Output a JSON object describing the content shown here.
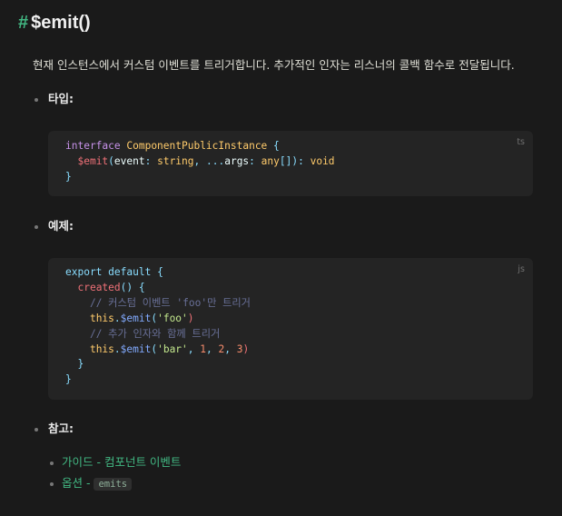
{
  "heading": {
    "hash": "#",
    "title": "$emit()"
  },
  "description": "현재 인스턴스에서 커스텀 이벤트를 트리거합니다. 추가적인 인자는 리스너의 콜백 함수로 전달됩니다.",
  "sections": {
    "type": {
      "label": "타입:",
      "lang": "ts",
      "line1": {
        "kw": "interface",
        "name": "ComponentPublicInstance",
        "brace": " {"
      },
      "line2": {
        "fn": "$emit",
        "p1": "(",
        "arg1": "event",
        "c1": ": ",
        "t1": "string",
        "sep": ", ",
        "spread": "...",
        "arg2": "args",
        "c2": ": ",
        "t2": "any",
        "arr": "[]",
        "p2": ")",
        "c3": ": ",
        "ret": "void"
      },
      "line3": "}"
    },
    "example": {
      "label": "예제:",
      "lang": "js",
      "l1": {
        "kw1": "export",
        "kw2": "default",
        "brace": "{"
      },
      "l2": {
        "fn": "created",
        "rest": "() {"
      },
      "l3": "// 커스텀 이벤트 'foo'만 트리거",
      "l4": {
        "this": "this",
        "dot": ".",
        "meth": "$emit",
        "open": "(",
        "str": "'foo'",
        "close": ")"
      },
      "l5": "// 추가 인자와 함께 트리거",
      "l6": {
        "this": "this",
        "dot": ".",
        "meth": "$emit",
        "open": "(",
        "str": "'bar'",
        "sep1": ", ",
        "n1": "1",
        "sep2": ", ",
        "n2": "2",
        "sep3": ", ",
        "n3": "3",
        "close": ")"
      },
      "l7": "}",
      "l8": "}"
    },
    "refs": {
      "label": "참고:",
      "items": [
        {
          "text": "가이드 - 컴포넌트 이벤트"
        },
        {
          "text": "옵션",
          "dash": " - ",
          "code": "emits"
        }
      ]
    }
  }
}
